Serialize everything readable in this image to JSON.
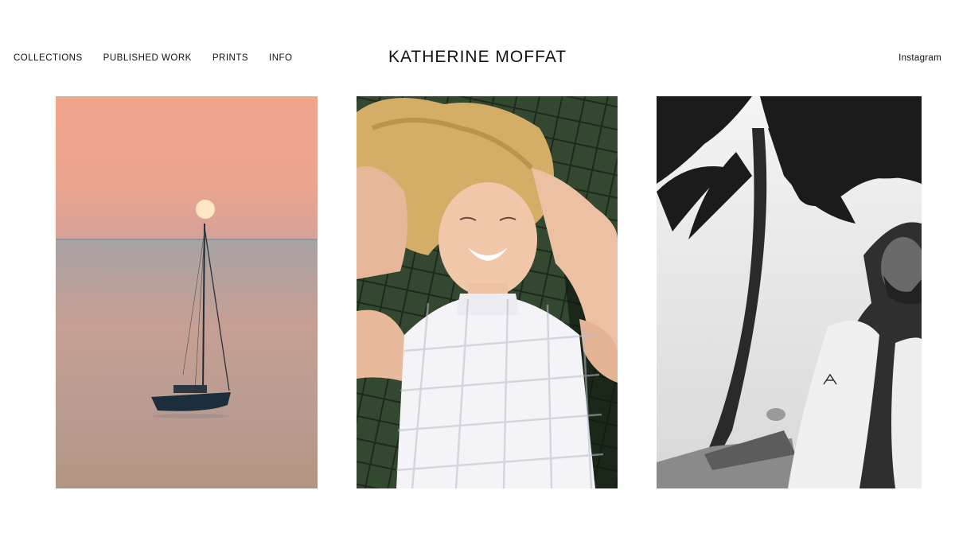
{
  "header": {
    "nav": [
      {
        "label": "COLLECTIONS"
      },
      {
        "label": "PUBLISHED WORK"
      },
      {
        "label": "PRINTS"
      },
      {
        "label": "INFO"
      }
    ],
    "title": "KATHERINE MOFFAT",
    "social_link": "Instagram"
  },
  "gallery": {
    "photos": [
      {
        "subject": "sailboat at sunset on calm sea",
        "palette": [
          "#f2a98e",
          "#d89a8e",
          "#8e8f97",
          "#1e2f3a"
        ]
      },
      {
        "subject": "laughing woman lying on net in sunlight",
        "palette": [
          "#d9b36a",
          "#3f5238",
          "#f5f5f8",
          "#f0c9b0"
        ]
      },
      {
        "subject": "black and white man with towel under palm trees",
        "palette": [
          "#e9e9e9",
          "#1c1c1c",
          "#8a8a8a"
        ]
      }
    ]
  },
  "colors": {
    "background": "#ffffff",
    "text": "#111111"
  }
}
